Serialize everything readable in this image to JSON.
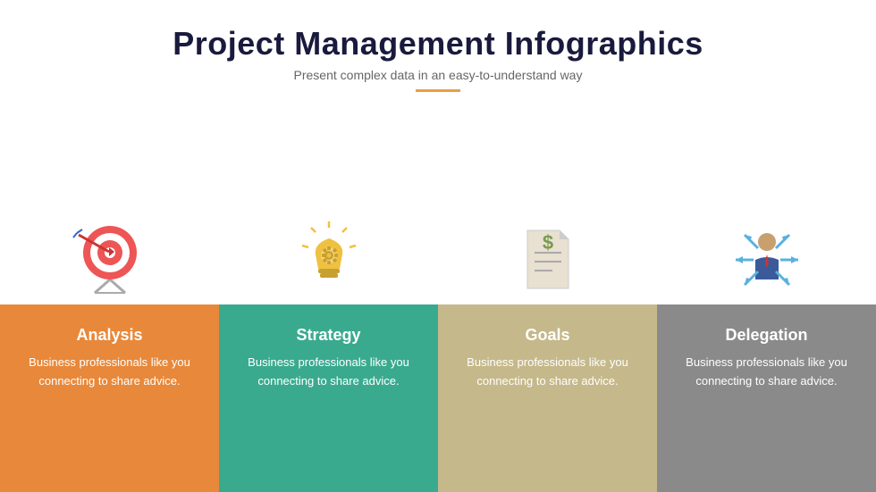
{
  "header": {
    "title": "Project Management Infographics",
    "subtitle": "Present complex data in an easy-to-understand way"
  },
  "cards": [
    {
      "id": "analysis",
      "title": "Analysis",
      "color_class": "card-orange",
      "text": "Business professionals like you connecting to share advice."
    },
    {
      "id": "strategy",
      "title": "Strategy",
      "color_class": "card-teal",
      "text": "Business professionals like you connecting to share advice."
    },
    {
      "id": "goals",
      "title": "Goals",
      "color_class": "card-tan",
      "text": "Business professionals like you connecting to share advice."
    },
    {
      "id": "delegation",
      "title": "Delegation",
      "color_class": "card-gray",
      "text": "Business professionals like you connecting to share advice."
    }
  ]
}
